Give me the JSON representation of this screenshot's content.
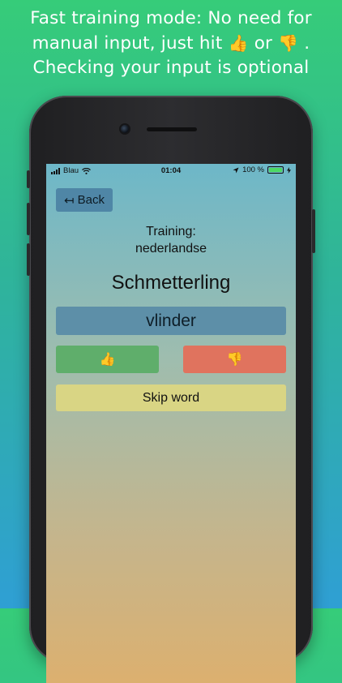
{
  "promo": {
    "line1": "Fast training mode: No need for",
    "line2_text": "manual input, just hit",
    "line2_or": "or",
    "line2_end": ".",
    "line3": "Checking your input is optional",
    "thumb_up_glyph": "👍",
    "thumb_down_glyph": "👎"
  },
  "status_bar": {
    "carrier": "Blau",
    "time": "01:04",
    "battery": "100 %",
    "battery_level": 1.0
  },
  "app": {
    "back_label": "Back",
    "back_arrow": "↤",
    "training_label": "Training:",
    "language": "nederlandse",
    "word": "Schmetterling",
    "answer": "vlinder",
    "thumb_up": "👍",
    "thumb_down": "👎",
    "skip_label": "Skip word"
  },
  "colors": {
    "promo_background_top": "#36cc79",
    "promo_background_bottom": "#2f9fd4",
    "back_button": "#4f86a6",
    "answer_field": "#5d8fa8",
    "thumb_up_button": "#5fae6b",
    "thumb_down_button": "#e0735e",
    "skip_button": "#d9d584"
  }
}
